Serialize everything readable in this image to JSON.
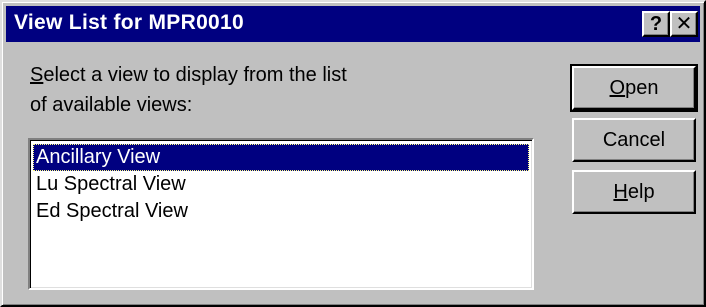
{
  "window": {
    "title": "View List for MPR0010",
    "help_glyph": "?",
    "close_glyph": "✕"
  },
  "prompt": {
    "line1": "Select a view to display from the list",
    "line2": "of available views:",
    "line1_access_key": "S"
  },
  "views": {
    "items": [
      {
        "label": "Ancillary View",
        "selected": true
      },
      {
        "label": "Lu Spectral View",
        "selected": false
      },
      {
        "label": "Ed Spectral View",
        "selected": false
      }
    ]
  },
  "buttons": {
    "open_label": "Open",
    "open_access_key": "O",
    "cancel_label": "Cancel",
    "help_label": "Help",
    "help_access_key": "H"
  },
  "colors": {
    "titlebar": "#000080",
    "face": "#c0c0c0",
    "selection": "#000080"
  }
}
